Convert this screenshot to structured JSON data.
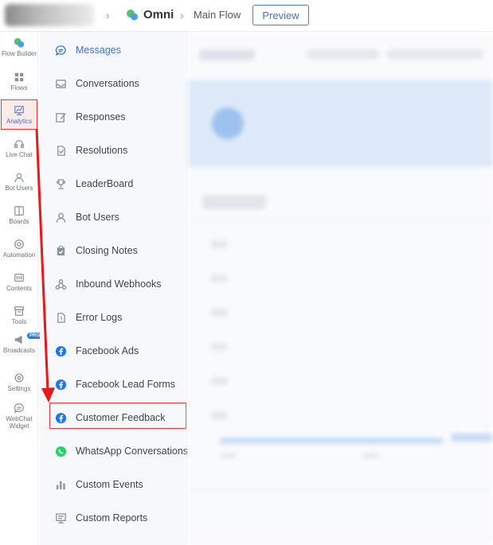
{
  "header": {
    "project": "Omni",
    "flow": "Main Flow",
    "preview_label": "Preview"
  },
  "rail": {
    "items": [
      {
        "label": "Flow Builder",
        "icon": "flow-builder-icon"
      },
      {
        "label": "Flows",
        "icon": "grid-icon"
      },
      {
        "label": "Analytics",
        "icon": "analytics-icon"
      },
      {
        "label": "Live Chat",
        "icon": "headset-icon"
      },
      {
        "label": "Bot Users",
        "icon": "user-icon"
      },
      {
        "label": "Boards",
        "icon": "board-icon"
      },
      {
        "label": "Automation",
        "icon": "automation-icon"
      },
      {
        "label": "Contents",
        "icon": "contents-icon"
      },
      {
        "label": "Tools",
        "icon": "tools-icon"
      },
      {
        "label": "Broadcasts",
        "icon": "megaphone-icon",
        "badge": "PRO"
      },
      {
        "label": "Settings",
        "icon": "gear-icon"
      },
      {
        "label": "WebChat",
        "label2": "Widget",
        "icon": "chat-bubble-icon"
      }
    ]
  },
  "submenu": {
    "items": [
      {
        "label": "Messages",
        "icon": "chat-bubble-icon",
        "active": true
      },
      {
        "label": "Conversations",
        "icon": "inbox-icon"
      },
      {
        "label": "Responses",
        "icon": "edit-icon"
      },
      {
        "label": "Resolutions",
        "icon": "check-doc-icon"
      },
      {
        "label": "LeaderBoard",
        "icon": "trophy-icon"
      },
      {
        "label": "Bot Users",
        "icon": "user-icon"
      },
      {
        "label": "Closing Notes",
        "icon": "clipboard-icon"
      },
      {
        "label": "Inbound Webhooks",
        "icon": "webhook-icon"
      },
      {
        "label": "Error Logs",
        "icon": "error-doc-icon"
      },
      {
        "label": "Facebook Ads",
        "icon": "facebook-icon"
      },
      {
        "label": "Facebook Lead Forms",
        "icon": "facebook-icon"
      },
      {
        "label": "Customer Feedback",
        "icon": "facebook-icon"
      },
      {
        "label": "WhatsApp Conversations",
        "icon": "whatsapp-icon"
      },
      {
        "label": "Custom Events",
        "icon": "bar-chart-icon"
      },
      {
        "label": "Custom Reports",
        "icon": "report-icon"
      }
    ]
  },
  "colors": {
    "accent": "#3f73c9",
    "highlight": "#e63838",
    "facebook": "#1877f2",
    "whatsapp": "#25d366"
  }
}
